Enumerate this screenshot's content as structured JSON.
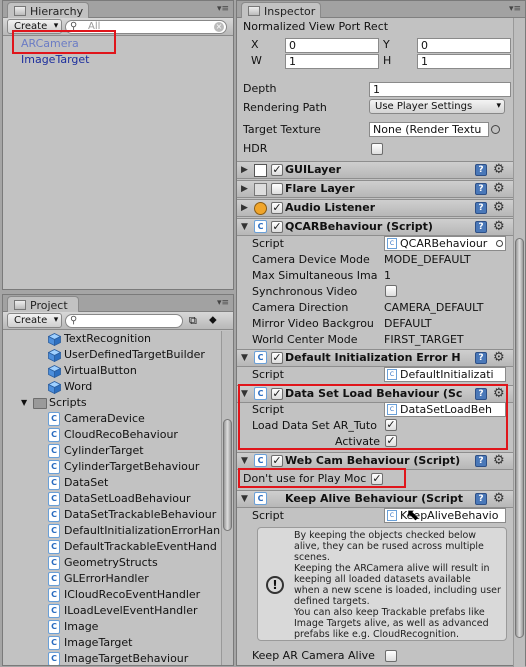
{
  "hierarchy": {
    "tab": "Hierarchy",
    "create": "Create",
    "search_placeholder": "All",
    "items": [
      "ARCamera",
      "ImageTarget"
    ]
  },
  "project": {
    "tab": "Project",
    "create": "Create",
    "items": [
      {
        "label": "TextRecognition",
        "icon": "cube-icon"
      },
      {
        "label": "UserDefinedTargetBuilder",
        "icon": "cube-icon"
      },
      {
        "label": "VirtualButton",
        "icon": "cube-icon"
      },
      {
        "label": "Word",
        "icon": "cube-icon"
      },
      {
        "label": "Scripts",
        "icon": "folder-icon"
      },
      {
        "label": "CameraDevice",
        "icon": "script-icon"
      },
      {
        "label": "CloudRecoBehaviour",
        "icon": "script-icon"
      },
      {
        "label": "CylinderTarget",
        "icon": "script-icon"
      },
      {
        "label": "CylinderTargetBehaviour",
        "icon": "script-icon"
      },
      {
        "label": "DataSet",
        "icon": "script-icon"
      },
      {
        "label": "DataSetLoadBehaviour",
        "icon": "script-icon"
      },
      {
        "label": "DataSetTrackableBehaviour",
        "icon": "script-icon"
      },
      {
        "label": "DefaultInitializationErrorHan",
        "icon": "script-icon"
      },
      {
        "label": "DefaultTrackableEventHand",
        "icon": "script-icon"
      },
      {
        "label": "GeometryStructs",
        "icon": "script-icon"
      },
      {
        "label": "GLErrorHandler",
        "icon": "script-icon"
      },
      {
        "label": "ICloudRecoEventHandler",
        "icon": "script-icon"
      },
      {
        "label": "ILoadLevelEventHandler",
        "icon": "script-icon"
      },
      {
        "label": "Image",
        "icon": "script-icon"
      },
      {
        "label": "ImageTarget",
        "icon": "script-icon"
      },
      {
        "label": "ImageTargetBehaviour",
        "icon": "script-icon"
      }
    ]
  },
  "inspector": {
    "tab": "Inspector",
    "viewport": {
      "title": "Normalized View Port Rect",
      "x_label": "X",
      "x": "0",
      "y_label": "Y",
      "y": "0",
      "w_label": "W",
      "w": "1",
      "h_label": "H",
      "h": "1"
    },
    "depth_label": "Depth",
    "depth": "1",
    "rendering_path_label": "Rendering Path",
    "rendering_path": "Use Player Settings",
    "target_texture_label": "Target Texture",
    "target_texture": "None (Render Textu",
    "hdr_label": "HDR",
    "components": {
      "guilayer": "GUILayer",
      "flare": "Flare Layer",
      "audio": "Audio Listener",
      "qcar": "QCARBehaviour (Script)",
      "init_error": "Default Initialization Error H",
      "dataset_load": "Data Set Load Behaviour (Sc",
      "webcam": "Web Cam Behaviour (Script)",
      "keep_alive": "Keep Alive Behaviour (Script"
    },
    "qcar": {
      "script_label": "Script",
      "script": "QCARBehaviour",
      "camera_device_mode_label": "Camera Device Mode",
      "camera_device_mode": "MODE_DEFAULT",
      "max_sim_label": "Max Simultaneous Ima",
      "max_sim": "1",
      "sync_video_label": "Synchronous Video",
      "camera_direction_label": "Camera Direction",
      "camera_direction": "CAMERA_DEFAULT",
      "mirror_label": "Mirror Video Backgrou",
      "mirror": "DEFAULT",
      "world_center_label": "World Center Mode",
      "world_center": "FIRST_TARGET"
    },
    "init_error": {
      "script_label": "Script",
      "script": "DefaultInitializati"
    },
    "dataset_load": {
      "script_label": "Script",
      "script": "DataSetLoadBeh",
      "load_label": "Load Data Set AR_Tuto",
      "activate_label": "Activate"
    },
    "webcam": {
      "dont_use_label": "Don't use for Play Moc"
    },
    "keep_alive": {
      "script_label": "Script",
      "script": "KeepAliveBehavio",
      "info_lines": [
        "By keeping the objects checked below",
        "alive, they can be rused across multiple",
        "scenes.",
        "Keeping the ARCamera alive will result in",
        "keeping all loaded datasets available",
        "when a new scene is loaded, including user",
        "defined targets.",
        "You can also keep Trackable prefabs like",
        "Image Targets alive, as well as advanced",
        "prefabs like e.g. CloudRecognition."
      ],
      "keep_ar_label": "Keep AR Camera Alive"
    }
  }
}
